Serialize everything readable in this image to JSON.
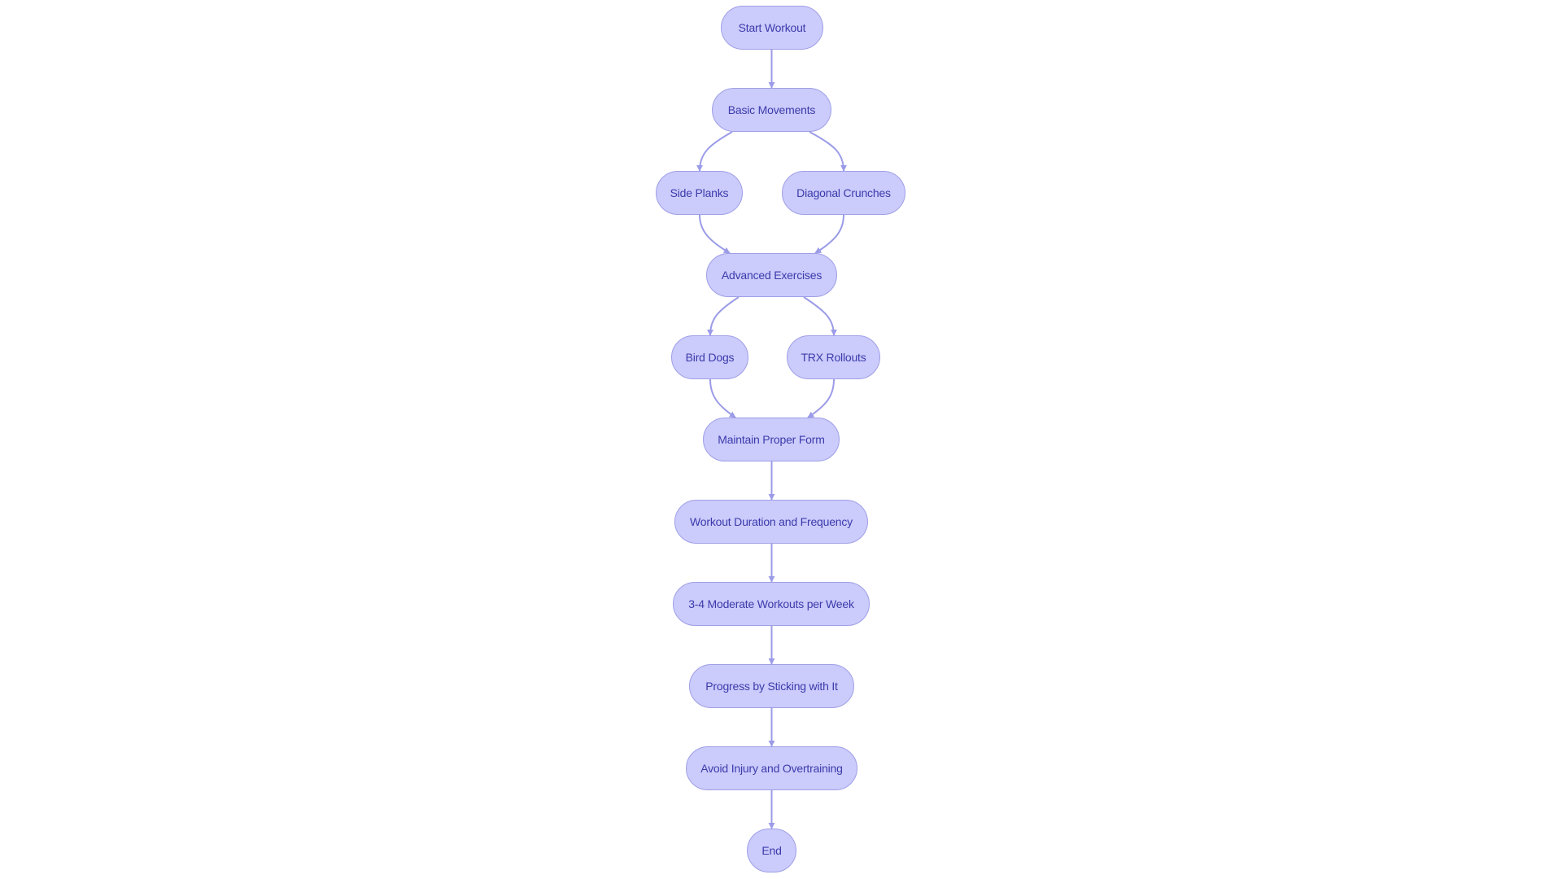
{
  "diagram": {
    "type": "flowchart",
    "direction": "top-down",
    "colors": {
      "node_fill": "#cbcbfc",
      "node_stroke": "#9f9fe6",
      "node_text": "#3b3bab",
      "edge": "#9b9be8",
      "background": "#ffffff"
    },
    "nodes": [
      {
        "id": "start",
        "label": "Start Workout"
      },
      {
        "id": "basic",
        "label": "Basic Movements"
      },
      {
        "id": "side_planks",
        "label": "Side Planks"
      },
      {
        "id": "diagonal_crunches",
        "label": "Diagonal Crunches"
      },
      {
        "id": "advanced",
        "label": "Advanced Exercises"
      },
      {
        "id": "bird_dogs",
        "label": "Bird Dogs"
      },
      {
        "id": "trx_rollouts",
        "label": "TRX Rollouts"
      },
      {
        "id": "form",
        "label": "Maintain Proper Form"
      },
      {
        "id": "duration",
        "label": "Workout Duration and Frequency"
      },
      {
        "id": "moderate",
        "label": "3-4 Moderate Workouts per Week"
      },
      {
        "id": "progress",
        "label": "Progress by Sticking with It"
      },
      {
        "id": "avoid_injury",
        "label": "Avoid Injury and Overtraining"
      },
      {
        "id": "end",
        "label": "End"
      }
    ],
    "edges": [
      {
        "from": "start",
        "to": "basic"
      },
      {
        "from": "basic",
        "to": "side_planks"
      },
      {
        "from": "basic",
        "to": "diagonal_crunches"
      },
      {
        "from": "side_planks",
        "to": "advanced"
      },
      {
        "from": "diagonal_crunches",
        "to": "advanced"
      },
      {
        "from": "advanced",
        "to": "bird_dogs"
      },
      {
        "from": "advanced",
        "to": "trx_rollouts"
      },
      {
        "from": "bird_dogs",
        "to": "form"
      },
      {
        "from": "trx_rollouts",
        "to": "form"
      },
      {
        "from": "form",
        "to": "duration"
      },
      {
        "from": "duration",
        "to": "moderate"
      },
      {
        "from": "moderate",
        "to": "progress"
      },
      {
        "from": "progress",
        "to": "avoid_injury"
      },
      {
        "from": "avoid_injury",
        "to": "end"
      }
    ]
  }
}
